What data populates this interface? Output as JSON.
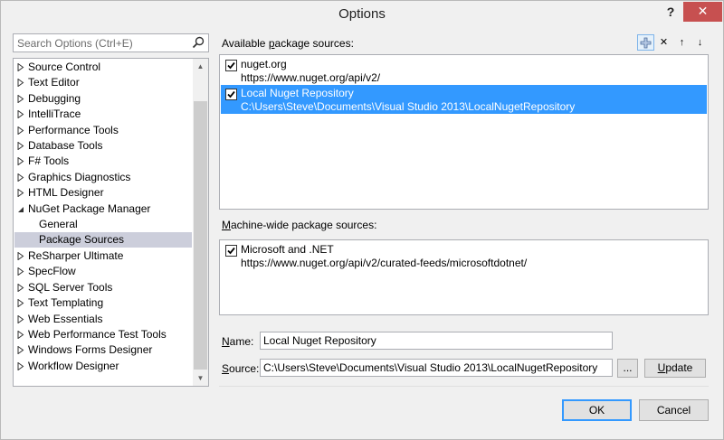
{
  "window": {
    "title": "Options",
    "help_label": "?",
    "close_label": "✕"
  },
  "search": {
    "placeholder": "Search Options (Ctrl+E)",
    "value": ""
  },
  "tree": {
    "items": [
      {
        "label": "Source Control",
        "expanded": false
      },
      {
        "label": "Text Editor",
        "expanded": false
      },
      {
        "label": "Debugging",
        "expanded": false
      },
      {
        "label": "IntelliTrace",
        "expanded": false
      },
      {
        "label": "Performance Tools",
        "expanded": false
      },
      {
        "label": "Database Tools",
        "expanded": false
      },
      {
        "label": "F# Tools",
        "expanded": false
      },
      {
        "label": "Graphics Diagnostics",
        "expanded": false
      },
      {
        "label": "HTML Designer",
        "expanded": false
      },
      {
        "label": "NuGet Package Manager",
        "expanded": true
      },
      {
        "label": "General",
        "child": true
      },
      {
        "label": "Package Sources",
        "child": true,
        "selected": true
      },
      {
        "label": "ReSharper Ultimate",
        "expanded": false
      },
      {
        "label": "SpecFlow",
        "expanded": false
      },
      {
        "label": "SQL Server Tools",
        "expanded": false
      },
      {
        "label": "Text Templating",
        "expanded": false
      },
      {
        "label": "Web Essentials",
        "expanded": false
      },
      {
        "label": "Web Performance Test Tools",
        "expanded": false
      },
      {
        "label": "Windows Forms Designer",
        "expanded": false
      },
      {
        "label": "Workflow Designer",
        "expanded": false
      }
    ]
  },
  "available": {
    "label_pre": "Available ",
    "label_accel": "p",
    "label_post": "ackage sources:",
    "toolbar": {
      "add_label": "+",
      "remove_label": "✕",
      "up_label": "↑",
      "down_label": "↓"
    },
    "sources": [
      {
        "name": "nuget.org",
        "url": "https://www.nuget.org/api/v2/",
        "checked": true,
        "selected": false
      },
      {
        "name": "Local Nuget Repository",
        "url": "C:\\Users\\Steve\\Documents\\Visual Studio 2013\\LocalNugetRepository",
        "checked": true,
        "selected": true
      }
    ]
  },
  "machine_wide": {
    "label_pre": "",
    "label_accel": "M",
    "label_post": "achine-wide package sources:",
    "sources": [
      {
        "name": "Microsoft and .NET",
        "url": "https://www.nuget.org/api/v2/curated-feeds/microsoftdotnet/",
        "checked": true
      }
    ]
  },
  "form": {
    "name_label_accel": "N",
    "name_label_post": "ame:",
    "name_value": "Local Nuget Repository",
    "source_label_accel": "S",
    "source_label_post": "ource:",
    "source_value": "C:\\Users\\Steve\\Documents\\Visual Studio 2013\\LocalNugetRepository",
    "browse_label": "...",
    "update_label_accel": "U",
    "update_label_post": "pdate"
  },
  "footer": {
    "ok_label": "OK",
    "cancel_label": "Cancel"
  },
  "colors": {
    "selection": "#3399ff",
    "tree_selection": "#cccedb",
    "close_button": "#c75050"
  }
}
